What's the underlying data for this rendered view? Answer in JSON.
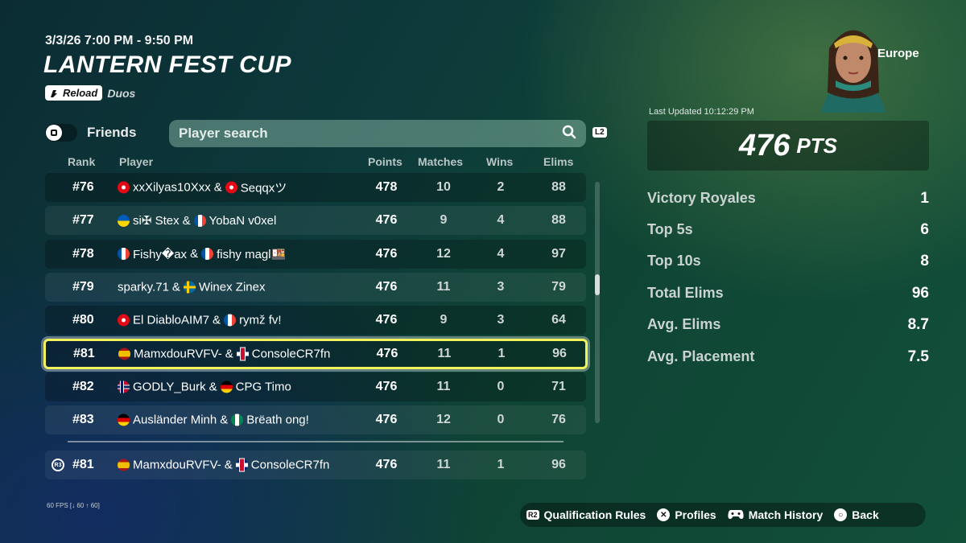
{
  "event": {
    "date": "3/3/26 7:00 PM - 9:50 PM",
    "title": "LANTERN FEST CUP",
    "mode_badge": "Reload",
    "team_size": "Duos"
  },
  "filters": {
    "friends_label": "Friends",
    "friends_toggle_on": false,
    "search_placeholder": "Player search",
    "search_value": "",
    "search_shortcut": "L2"
  },
  "table": {
    "headers": {
      "rank": "Rank",
      "player": "Player",
      "points": "Points",
      "matches": "Matches",
      "wins": "Wins",
      "elims": "Elims"
    },
    "rows": [
      {
        "rank": "#76",
        "flag1": "tr",
        "p1": "xxXilyas10Xxx",
        "sep": "&",
        "flag2": "tr",
        "p2": "Seqqxツ",
        "points": "478",
        "matches": "10",
        "wins": "2",
        "elims": "88",
        "selected": false
      },
      {
        "rank": "#77",
        "flag1": "ua",
        "p1": "si✠ Stex",
        "sep": "&",
        "flag2": "fr",
        "p2": "YobaN v0xel",
        "points": "476",
        "matches": "9",
        "wins": "4",
        "elims": "88",
        "selected": false
      },
      {
        "rank": "#78",
        "flag1": "fr",
        "p1": "Fishy�ax",
        "sep": "&",
        "flag2": "fr",
        "p2": "fishy magl🍱",
        "points": "476",
        "matches": "12",
        "wins": "4",
        "elims": "97",
        "selected": false
      },
      {
        "rank": "#79",
        "flag1": "",
        "p1": "sparky.71",
        "sep": "&",
        "flag2": "se",
        "p2": "Winex Zinex",
        "points": "476",
        "matches": "11",
        "wins": "3",
        "elims": "79",
        "selected": false
      },
      {
        "rank": "#80",
        "flag1": "tr",
        "p1": "El DiabloAIM7",
        "sep": "&",
        "flag2": "fr",
        "p2": "rymž fv!",
        "points": "476",
        "matches": "9",
        "wins": "3",
        "elims": "64",
        "selected": false
      },
      {
        "rank": "#81",
        "flag1": "es",
        "p1": "MamxdouRVFV-",
        "sep": "&",
        "flag2": "gb",
        "p2": "ConsoleCR7fn",
        "points": "476",
        "matches": "11",
        "wins": "1",
        "elims": "96",
        "selected": true
      },
      {
        "rank": "#82",
        "flag1": "no",
        "p1": "GODLY_Burk",
        "sep": "&",
        "flag2": "de",
        "p2": "CPG Timo",
        "points": "476",
        "matches": "11",
        "wins": "0",
        "elims": "71",
        "selected": false
      },
      {
        "rank": "#83",
        "flag1": "de",
        "p1": "Ausländer Minh",
        "sep": "&",
        "flag2": "ng",
        "p2": "Brëath ong!",
        "points": "476",
        "matches": "12",
        "wins": "0",
        "elims": "76",
        "selected": false
      }
    ],
    "own_row": {
      "button": "R3",
      "rank": "#81",
      "flag1": "es",
      "p1": "MamxdouRVFV-",
      "sep": "&",
      "flag2": "gb",
      "p2": "ConsoleCR7fn",
      "points": "476",
      "matches": "11",
      "wins": "1",
      "elims": "96"
    },
    "scroll_position": 0.42
  },
  "summary": {
    "region": "Europe",
    "last_updated": "Last Updated 10:12:29 PM",
    "points": "476",
    "points_unit": "PTS",
    "stats": [
      {
        "label": "Victory Royales",
        "value": "1"
      },
      {
        "label": "Top 5s",
        "value": "6"
      },
      {
        "label": "Top 10s",
        "value": "8"
      },
      {
        "label": "Total Elims",
        "value": "96"
      },
      {
        "label": "Avg. Elims",
        "value": "8.7"
      },
      {
        "label": "Avg. Placement",
        "value": "7.5"
      }
    ]
  },
  "footer": {
    "fps": "60 FPS [↓ 60 ↑ 60]",
    "buttons": [
      {
        "key": "R2",
        "label": "Qualification Rules"
      },
      {
        "key": "✕",
        "label": "Profiles"
      },
      {
        "key": "gamepad",
        "label": "Match History"
      },
      {
        "key": "○",
        "label": "Back"
      }
    ]
  },
  "colors": {
    "highlight": "#f2f25a",
    "bg_dark": "#0b2c33",
    "bg_green": "#12503a"
  }
}
